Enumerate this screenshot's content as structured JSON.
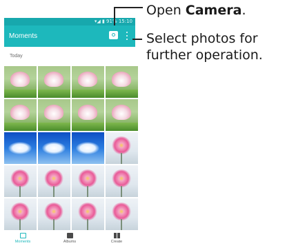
{
  "statusbar": {
    "text": "▾◢ ▮ 91% 15:10"
  },
  "appbar": {
    "title": "Moments",
    "camera_icon": "camera-icon",
    "more_icon": "more-vert-icon"
  },
  "section": {
    "label": "Today"
  },
  "grid": {
    "rows": [
      [
        "lotus",
        "lotus",
        "lotus",
        "lotus"
      ],
      [
        "lotus",
        "lotus",
        "lotus",
        "lotus"
      ],
      [
        "sky",
        "sky",
        "sky",
        "pinkflower"
      ],
      [
        "pinkflower",
        "pinkflower",
        "pinkflower",
        "pinkflower"
      ],
      [
        "pinkflower",
        "pinkflower",
        "pinkflower",
        "pinkflower"
      ]
    ]
  },
  "bottomnav": {
    "items": [
      {
        "label": "Moments",
        "icon": "moments-icon",
        "active": true
      },
      {
        "label": "Albums",
        "icon": "albums-icon",
        "active": false
      },
      {
        "label": "Create",
        "icon": "create-icon",
        "active": false
      }
    ]
  },
  "callouts": {
    "camera_prefix": "Open ",
    "camera_bold": "Camera",
    "camera_suffix": ".",
    "select_line1": "Select photos for",
    "select_line2": "further operation."
  },
  "colors": {
    "accent": "#1db8bc",
    "statusbar": "#17a8ad"
  }
}
